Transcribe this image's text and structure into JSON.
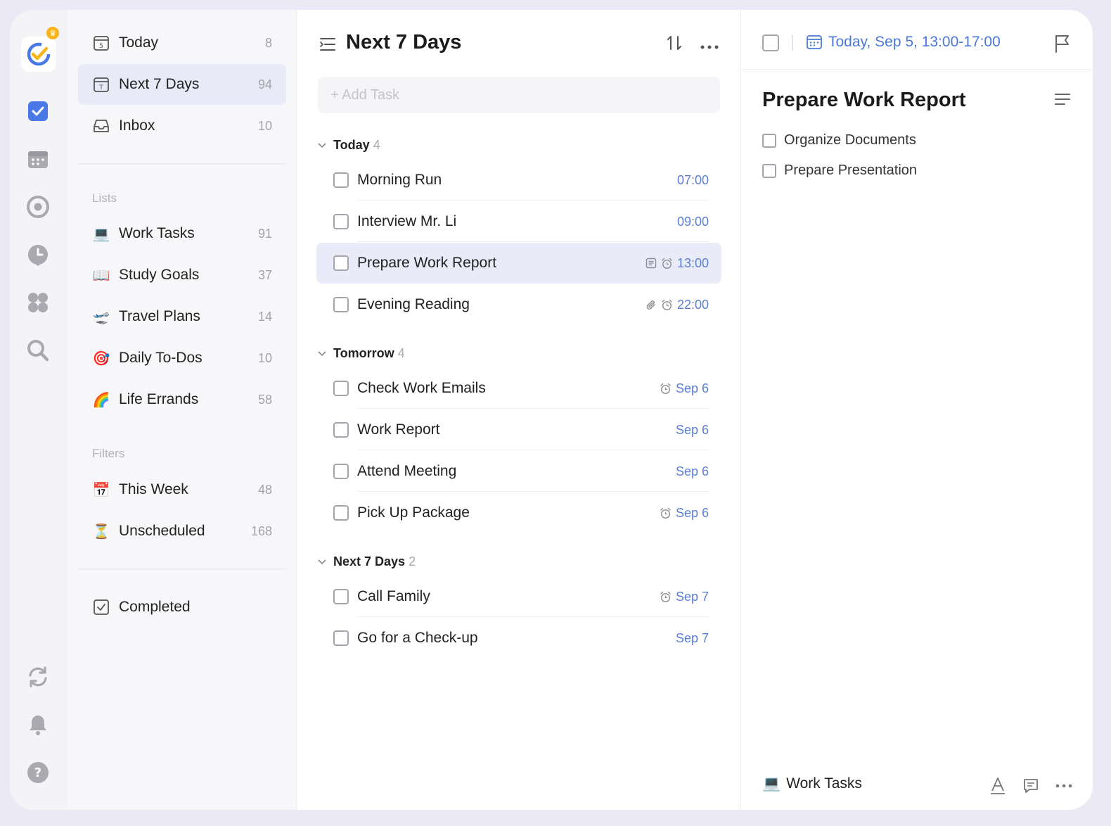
{
  "sidebar": {
    "nav": [
      {
        "label": "Today",
        "count": "8",
        "icon": "calendar-5-icon"
      },
      {
        "label": "Next 7 Days",
        "count": "94",
        "icon": "calendar-t-icon"
      },
      {
        "label": "Inbox",
        "count": "10",
        "icon": "inbox-icon"
      }
    ],
    "lists_title": "Lists",
    "lists": [
      {
        "emoji": "💻",
        "label": "Work Tasks",
        "count": "91"
      },
      {
        "emoji": "📖",
        "label": "Study Goals",
        "count": "37"
      },
      {
        "emoji": "🛫",
        "label": "Travel Plans",
        "count": "14"
      },
      {
        "emoji": "🎯",
        "label": "Daily To-Dos",
        "count": "10"
      },
      {
        "emoji": "🌈",
        "label": "Life Errands",
        "count": "58"
      }
    ],
    "filters_title": "Filters",
    "filters": [
      {
        "emoji": "📅",
        "label": "This Week",
        "count": "48"
      },
      {
        "emoji": "⏳",
        "label": "Unscheduled",
        "count": "168"
      }
    ],
    "completed": "Completed"
  },
  "middle": {
    "title": "Next 7 Days",
    "add_task": "+ Add Task",
    "groups": [
      {
        "name": "Today",
        "count": "4"
      },
      {
        "name": "Tomorrow",
        "count": "4"
      },
      {
        "name": "Next 7 Days",
        "count": "2"
      }
    ],
    "tasks": [
      {
        "title": "Morning Run",
        "time": "07:00"
      },
      {
        "title": "Interview Mr. Li",
        "time": "09:00"
      },
      {
        "title": "Prepare Work Report",
        "time": "13:00"
      },
      {
        "title": "Evening Reading",
        "time": "22:00"
      },
      {
        "title": "Check Work Emails",
        "time": "Sep 6"
      },
      {
        "title": "Work Report",
        "time": "Sep 6"
      },
      {
        "title": "Attend Meeting",
        "time": "Sep 6"
      },
      {
        "title": "Pick Up Package",
        "time": "Sep 6"
      },
      {
        "title": "Call Family",
        "time": "Sep 7"
      },
      {
        "title": "Go for a Check-up",
        "time": "Sep 7"
      }
    ]
  },
  "detail": {
    "date": "Today, Sep 5, 13:00-17:00",
    "title": "Prepare Work Report",
    "subtasks": [
      "Organize Documents",
      "Prepare Presentation"
    ],
    "list_name": "Work Tasks",
    "list_emoji": "💻"
  },
  "colors": {
    "accent": "#4a78d6",
    "active_bg": "#e9ecf8"
  }
}
